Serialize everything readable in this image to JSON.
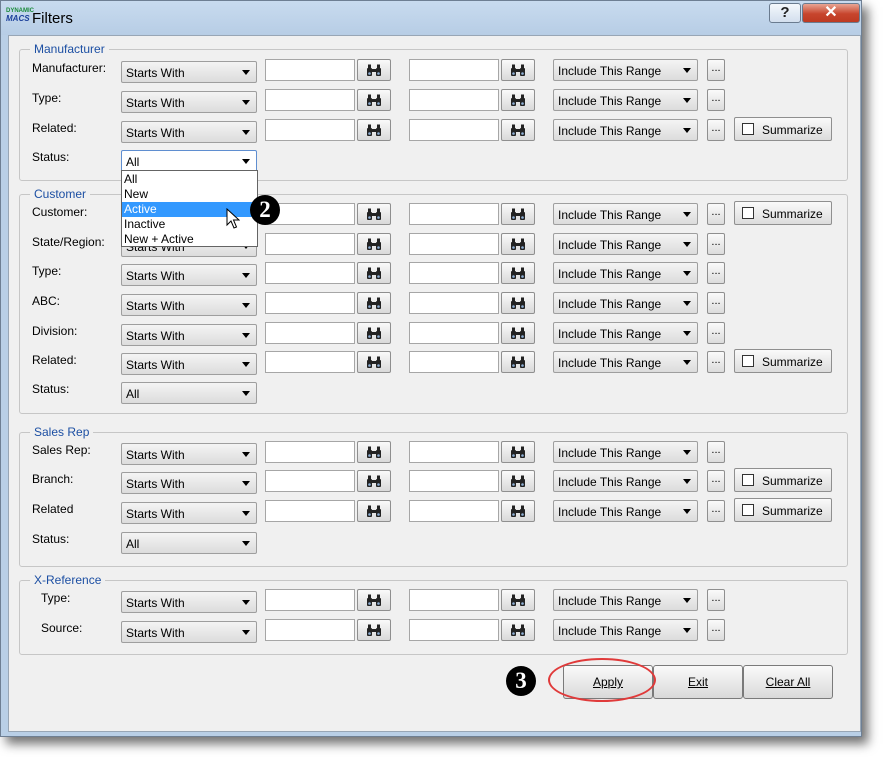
{
  "window": {
    "title": "Filters",
    "logo_text_top": "DYNAMIC",
    "logo_text_bottom": "MACS",
    "help_glyph": "?",
    "close_glyph": "✕"
  },
  "groups": {
    "manufacturer": {
      "title": "Manufacturer"
    },
    "customer": {
      "title": "Customer"
    },
    "sales_rep": {
      "title": "Sales Rep"
    },
    "xref": {
      "title": "X-Reference"
    }
  },
  "rows": [
    {
      "label": "Manufacturer:",
      "match": "Starts With",
      "range": "Include This Range",
      "summarize": false
    },
    {
      "label": "Type:",
      "match": "Starts With",
      "range": "Include This Range",
      "summarize": false
    },
    {
      "label": "Related:",
      "match": "Starts With",
      "range": "Include This Range",
      "summarize": true
    },
    {
      "label": "Status:",
      "status_value": "All"
    },
    {
      "label": "Customer:",
      "match": "Starts With",
      "range": "Include This Range",
      "summarize": true
    },
    {
      "label": "State/Region:",
      "match": "Starts With",
      "range": "Include This Range",
      "summarize": false
    },
    {
      "label": "Type:",
      "match": "Starts With",
      "range": "Include This Range",
      "summarize": false
    },
    {
      "label": "ABC:",
      "match": "Starts With",
      "range": "Include This Range",
      "summarize": false
    },
    {
      "label": "Division:",
      "match": "Starts With",
      "range": "Include This Range",
      "summarize": false
    },
    {
      "label": "Related:",
      "match": "Starts With",
      "range": "Include This Range",
      "summarize": true
    },
    {
      "label": "Status:",
      "status_value": "All"
    },
    {
      "label": "Sales Rep:",
      "match": "Starts With",
      "range": "Include This Range",
      "summarize": false
    },
    {
      "label": "Branch:",
      "match": "Starts With",
      "range": "Include This Range",
      "summarize": true
    },
    {
      "label": "Related",
      "match": "Starts With",
      "range": "Include This Range",
      "summarize": true
    },
    {
      "label": "Status:",
      "status_value": "All"
    },
    {
      "label": "Type:",
      "match": "Starts With",
      "range": "Include This Range",
      "summarize": false
    },
    {
      "label": "Source:",
      "match": "Starts With",
      "range": "Include This Range",
      "summarize": false
    }
  ],
  "summarize_label": "Summarize",
  "ellipsis": "...",
  "status_dropdown": {
    "options": [
      "All",
      "New",
      "Active",
      "Inactive",
      "New + Active"
    ],
    "highlighted": "Active"
  },
  "callouts": [
    "2",
    "3"
  ],
  "buttons": {
    "apply": "Apply",
    "exit": "Exit",
    "clear_all": "Clear All"
  },
  "colors": {
    "group_title": "#1c4fa3",
    "highlight": "#3399ff",
    "callout_ring": "#e03a3a",
    "close_button": "#c7452d"
  }
}
